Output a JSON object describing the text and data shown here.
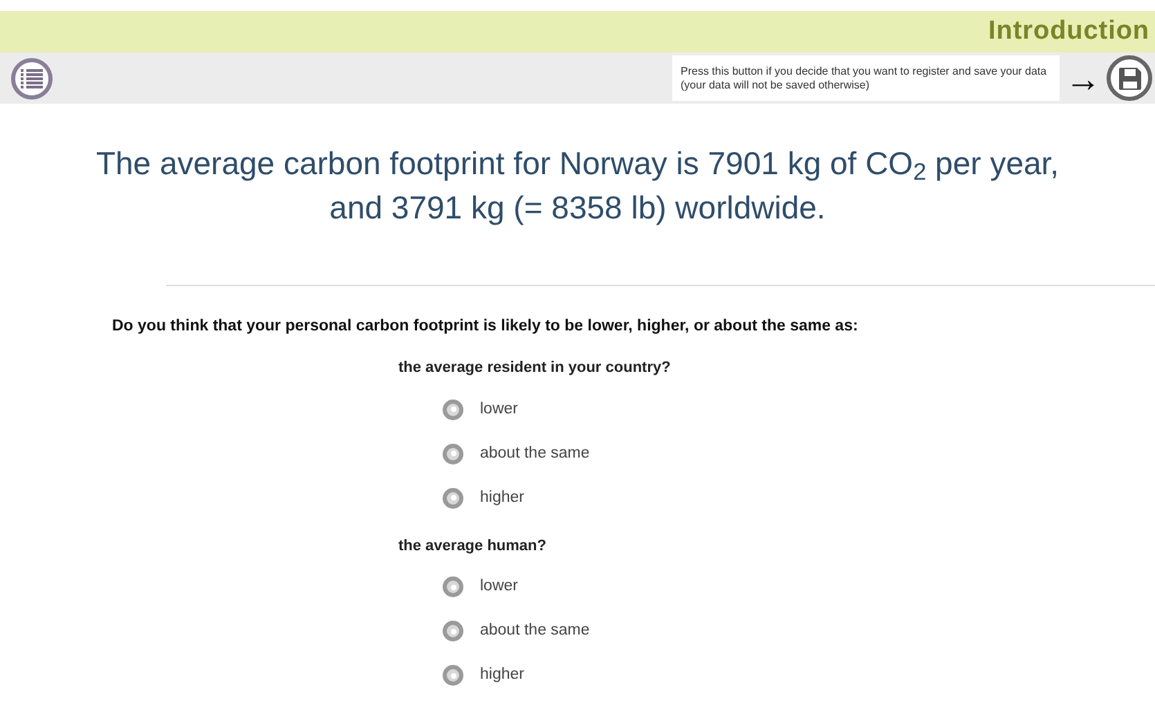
{
  "header": {
    "title": "Introduction"
  },
  "toolbar": {
    "save_hint": "Press this button if you decide that you want to register and save your data (your data will not be saved otherwise)",
    "arrow": "→"
  },
  "headline": "The average carbon footprint for Norway is 7901 kg of CO$_{2}$ per year, and 3791 kg (= 8358 lb) worldwide.",
  "question": "Do you think that your personal carbon footprint is likely to be lower, higher, or about the same as:",
  "groups": [
    {
      "label": "the average resident in your country?",
      "options": [
        {
          "label": "lower",
          "selected": false
        },
        {
          "label": "about the same",
          "selected": false
        },
        {
          "label": "higher",
          "selected": false
        }
      ]
    },
    {
      "label": "the average human?",
      "options": [
        {
          "label": "lower",
          "selected": false
        },
        {
          "label": "about the same",
          "selected": false
        },
        {
          "label": "higher",
          "selected": false
        }
      ]
    }
  ]
}
